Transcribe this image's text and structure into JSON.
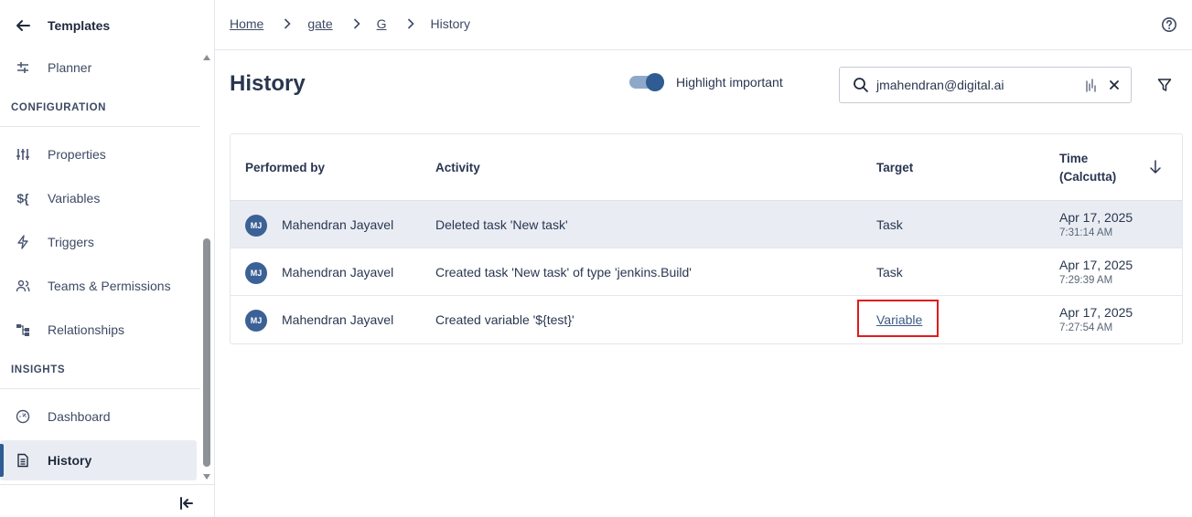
{
  "sidebar": {
    "header_title": "Templates",
    "items": [
      {
        "label": "Planner",
        "icon": "planner-icon"
      },
      {
        "label": "Properties",
        "icon": "sliders-icon"
      },
      {
        "label": "Variables",
        "icon": "variable-icon"
      },
      {
        "label": "Triggers",
        "icon": "bolt-icon"
      },
      {
        "label": "Teams & Permissions",
        "icon": "users-icon"
      },
      {
        "label": "Relationships",
        "icon": "relationships-icon"
      },
      {
        "label": "Dashboard",
        "icon": "dashboard-icon"
      },
      {
        "label": "History",
        "icon": "document-icon",
        "active": true
      }
    ],
    "sections": [
      "CONFIGURATION",
      "INSIGHTS"
    ]
  },
  "breadcrumb": [
    {
      "label": "Home",
      "link": true
    },
    {
      "label": "gate",
      "link": true
    },
    {
      "label": "G",
      "link": true
    },
    {
      "label": "History",
      "link": false
    }
  ],
  "page": {
    "title": "History",
    "toggle_label": "Highlight important",
    "toggle_on": true
  },
  "search": {
    "value": "jmahendran@digital.ai"
  },
  "table": {
    "columns": [
      "Performed by",
      "Activity",
      "Target",
      "Time",
      "(Calcutta)"
    ],
    "rows": [
      {
        "initials": "MJ",
        "user": "Mahendran Jayavel",
        "activity": "Deleted task 'New task'",
        "target": "Task",
        "date": "Apr 17, 2025",
        "time": "7:31:14 AM",
        "highlighted": true
      },
      {
        "initials": "MJ",
        "user": "Mahendran Jayavel",
        "activity": "Created task 'New task' of type 'jenkins.Build'",
        "target": "Task",
        "date": "Apr 17, 2025",
        "time": "7:29:39 AM",
        "highlighted": false
      },
      {
        "initials": "MJ",
        "user": "Mahendran Jayavel",
        "activity": "Created variable '${test}'",
        "target": "Variable",
        "date": "Apr 17, 2025",
        "time": "7:27:54 AM",
        "highlighted": false,
        "target_link": true
      }
    ]
  },
  "colors": {
    "accent": "#2e5c93",
    "highlight_row": "#e9edf3",
    "annotation_box": "#e01b1b"
  }
}
